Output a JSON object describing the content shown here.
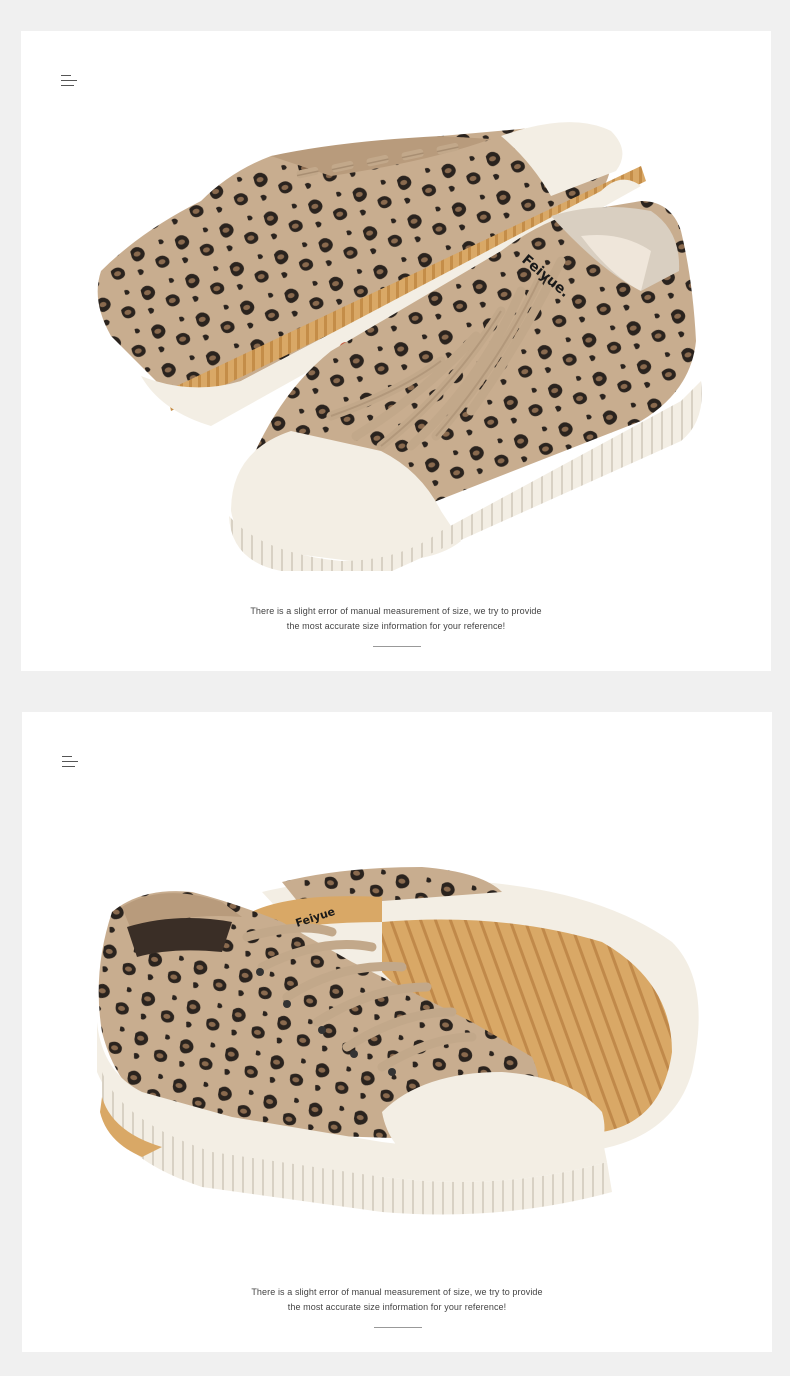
{
  "colors": {
    "page_bg": "#f0f0f0",
    "card_bg": "#ffffff",
    "canvas_tan": "#c8ad8f",
    "spot_dark": "#2a231e",
    "spot_brown": "#8a6a4e",
    "rubber": "#f3eee4",
    "outsole_gum": "#d9a866"
  },
  "cards": [
    {
      "menu_icon": "menu-icon",
      "product_image": "leopard-canvas-sneakers-pair-angled",
      "shoe_brand": "Feiyue.",
      "caption_line1": "There is a slight error of manual measurement of size, we try to provide",
      "caption_line2": "the most accurate size information for your reference!"
    },
    {
      "menu_icon": "menu-icon",
      "product_image": "leopard-canvas-sneakers-pair-side-and-sole",
      "shoe_brand": "Feiyue",
      "caption_line1": "There is a slight error of manual measurement of size, we try to provide",
      "caption_line2": "the most accurate size information for your reference!"
    }
  ]
}
